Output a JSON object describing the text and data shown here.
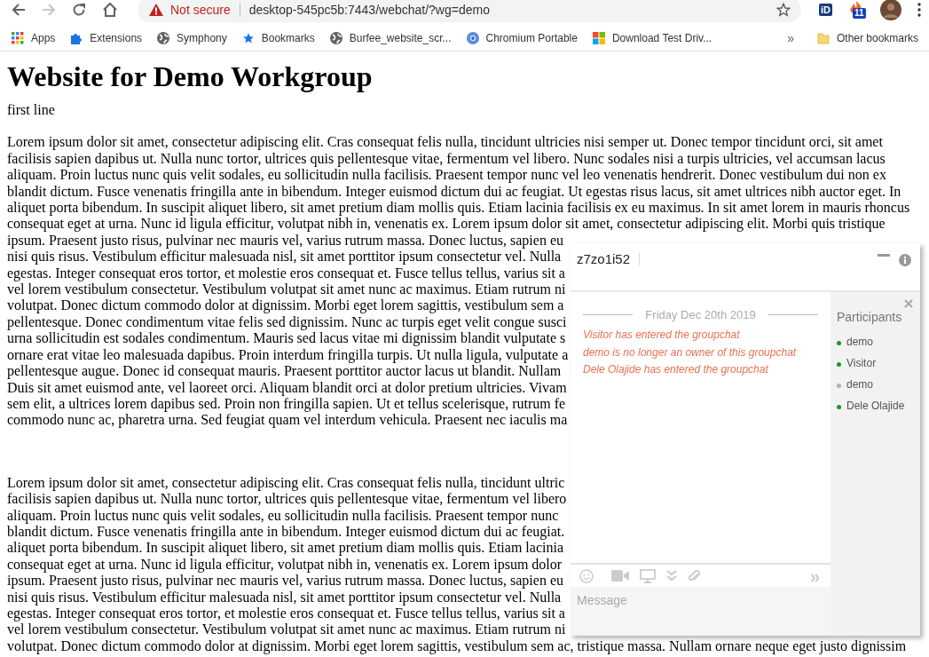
{
  "browser": {
    "nav": [
      {
        "kind": "back",
        "disabled": false
      },
      {
        "kind": "forward",
        "disabled": true
      },
      {
        "kind": "reload",
        "disabled": false
      },
      {
        "kind": "home",
        "disabled": false
      }
    ],
    "address": {
      "warning": "Not secure",
      "url": "desktop-545pc5b:7443/webchat/?wg=demo"
    },
    "extension_badge": "11",
    "extension_label": "iD",
    "bookmarks": [
      {
        "label": "Apps"
      },
      {
        "label": "Extensions"
      },
      {
        "label": "Symphony"
      },
      {
        "label": "Bookmarks"
      },
      {
        "label": "Burfee_website_scr..."
      },
      {
        "label": "Chromium Portable"
      },
      {
        "label": "Download Test Driv..."
      }
    ],
    "more": "»",
    "other_bookmarks": "Other bookmarks"
  },
  "page": {
    "heading": "Website for Demo Workgroup",
    "first_line": "first line",
    "paragraphs": [
      [
        "Lorem ipsum dolor sit amet, consectetur adipiscing elit. Cras consequat felis nulla, tincidunt ultricies nisi semper ut. Donec tempor tincidunt orci, sit amet",
        "facilisis sapien dapibus ut. Nulla nunc tortor, ultrices quis pellentesque vitae, fermentum vel libero. Nunc sodales nisi a turpis ultricies, vel accumsan lacus",
        "aliquam. Proin luctus nunc quis velit sodales, eu sollicitudin nulla facilisis. Praesent tempor nunc vel leo venenatis hendrerit. Donec vestibulum dui non ex",
        "blandit dictum. Fusce venenatis fringilla ante in bibendum. Integer euismod dictum dui ac feugiat. Ut egestas risus lacus, sit amet ultrices nibh auctor eget. In",
        "aliquet porta bibendum. In suscipit aliquet libero, sit amet pretium diam mollis quis. Etiam lacinia facilisis ex eu maximus. In sit amet lorem in mauris rhoncus",
        "consequat eget at urna. Nunc id ligula efficitur, volutpat nibh in, venenatis ex. Lorem ipsum dolor sit amet, consectetur adipiscing elit. Morbi quis tristique",
        "ipsum. Praesent justo risus, pulvinar nec mauris vel, varius rutrum massa. Donec luctus, sapien eu",
        "nisi quis risus. Vestibulum efficitur malesuada nisl, sit amet porttitor ipsum consectetur vel. Nulla",
        "egestas. Integer consequat eros tortor, et molestie eros consequat et. Fusce tellus tellus, varius sit a",
        "vel lorem vestibulum consectetur. Vestibulum volutpat sit amet nunc ac maximus. Etiam rutrum ni",
        "volutpat. Donec dictum commodo dolor at dignissim. Morbi eget lorem sagittis, vestibulum sem a",
        "pellentesque. Donec condimentum vitae felis sed dignissim. Nunc ac turpis eget velit congue susci",
        "urna sollicitudin est sodales condimentum. Mauris sed lacus vitae mi dignissim blandit vulputate s",
        "ornare erat vitae leo malesuada dapibus. Proin interdum fringilla turpis. Ut nulla ligula, vulputate a",
        "pellentesque augue. Donec id consequat mauris. Praesent porttitor auctor lacus ut blandit. Nullam",
        "Duis sit amet euismod ante, vel laoreet orci. Aliquam blandit orci at dolor pretium ultricies. Vivam",
        "sem elit, a ultrices lorem dapibus sed. Proin non fringilla sapien. Ut et tellus scelerisque, rutrum fe",
        "commodo nunc ac, pharetra urna. Sed feugiat quam vel interdum vehicula. Praesent nec iaculis ma"
      ],
      [
        "Lorem ipsum dolor sit amet, consectetur adipiscing elit. Cras consequat felis nulla, tincidunt ultric",
        "facilisis sapien dapibus ut. Nulla nunc tortor, ultrices quis pellentesque vitae, fermentum vel libero",
        "aliquam. Proin luctus nunc quis velit sodales, eu sollicitudin nulla facilisis. Praesent tempor nunc",
        "blandit dictum. Fusce venenatis fringilla ante in bibendum. Integer euismod dictum dui ac feugiat.",
        "aliquet porta bibendum. In suscipit aliquet libero, sit amet pretium diam mollis quis. Etiam lacinia",
        "consequat eget at urna. Nunc id ligula efficitur, volutpat nibh in, venenatis ex. Lorem ipsum dolor",
        "ipsum. Praesent justo risus, pulvinar nec mauris vel, varius rutrum massa. Donec luctus, sapien eu",
        "nisi quis risus. Vestibulum efficitur malesuada nisl, sit amet porttitor ipsum consectetur vel. Nulla",
        "egestas. Integer consequat eros tortor, et molestie eros consequat et. Fusce tellus tellus, varius sit a",
        "vel lorem vestibulum consectetur. Vestibulum volutpat sit amet nunc ac maximus. Etiam rutrum ni",
        "volutpat. Donec dictum commodo dolor at dignissim. Morbi eget lorem sagittis, vestibulum sem ac, tristique massa. Nullam ornare neque eget justo dignissim"
      ]
    ]
  },
  "chat": {
    "title": "z7zo1i52",
    "date": "Friday Dec 20th 2019",
    "events": [
      "Visitor has entered the groupchat",
      "demo is no longer an owner of this groupchat",
      "Dele Olajide has entered the groupchat"
    ],
    "participants_heading": "Participants",
    "participants": [
      {
        "name": "demo",
        "color": "#1a9a1a"
      },
      {
        "name": "Visitor",
        "color": "#1a9a1a"
      },
      {
        "name": "demo",
        "color": "#b0b0b0"
      },
      {
        "name": "Dele Olajide",
        "color": "#1a9a1a"
      }
    ],
    "send": "»",
    "placeholder": "Message"
  }
}
